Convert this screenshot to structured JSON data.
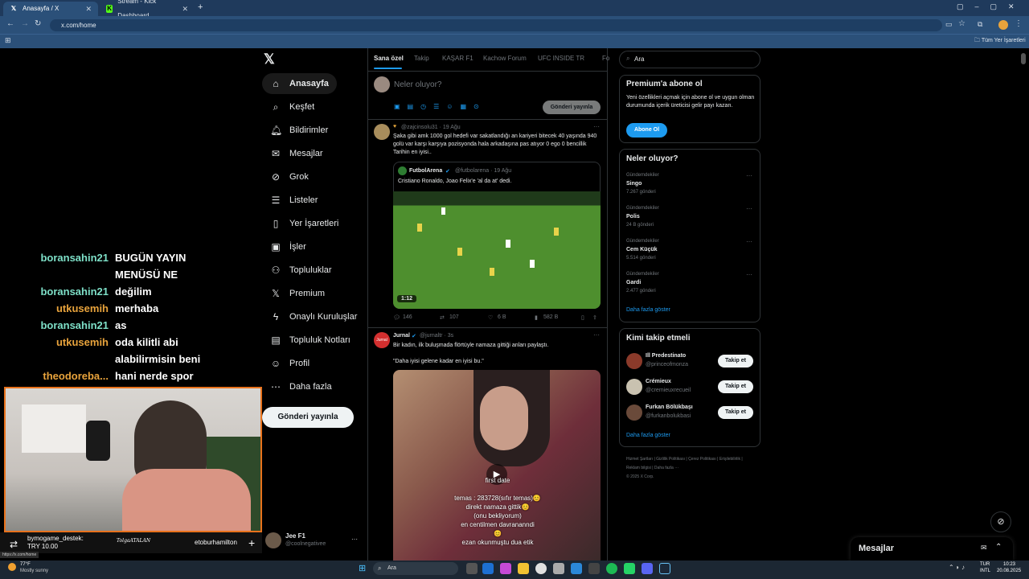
{
  "browser": {
    "tabs": [
      {
        "label": "Anasayfa / X",
        "icon": "x-logo-icon"
      },
      {
        "label": "Stream - Kick Dashboard",
        "icon": "kick-logo-icon"
      }
    ],
    "new_tab": "+",
    "url": "x.com/home",
    "bookmarks_folder": "Tüm Yer İşaretleri"
  },
  "x": {
    "nav": [
      {
        "label": "Anasayfa",
        "icon": "home-icon"
      },
      {
        "label": "Keşfet",
        "icon": "search-icon"
      },
      {
        "label": "Bildirimler",
        "icon": "bell-icon"
      },
      {
        "label": "Mesajlar",
        "icon": "mail-icon"
      },
      {
        "label": "Grok",
        "icon": "grok-icon"
      },
      {
        "label": "Listeler",
        "icon": "list-icon"
      },
      {
        "label": "Yer İşaretleri",
        "icon": "bookmark-icon"
      },
      {
        "label": "İşler",
        "icon": "briefcase-icon"
      },
      {
        "label": "Topluluklar",
        "icon": "people-icon"
      },
      {
        "label": "Premium",
        "icon": "x-premium-icon"
      },
      {
        "label": "Onaylı Kuruluşlar",
        "icon": "lightning-icon"
      },
      {
        "label": "Topluluk Notları",
        "icon": "notes-icon"
      },
      {
        "label": "Profil",
        "icon": "profile-icon"
      },
      {
        "label": "Daha fazla",
        "icon": "more-icon"
      }
    ],
    "post_button": "Gönderi yayınla",
    "account": {
      "name": "Jee F1",
      "handle": "@coolnegativee",
      "more": "···"
    },
    "feed_tabs": [
      "Sana özel",
      "Takip",
      "KAŞAR F1",
      "Kachow Forum",
      "UFC INSIDE TR",
      "Fo"
    ],
    "composer": {
      "placeholder": "Neler oluyor?",
      "post_button": "Gönderi yayınla"
    },
    "tweets": [
      {
        "handle": "@zajcinsolu31 · 19 Ağu",
        "text": "Şaka gibi amk 1000 gol hedefi var sakatlandığı an kariyeri bitecek 40 yaşında 940 golü var karşı karşıya pozisyonda hala arkadaşına pas atıyor 0 ego 0 bencillik Tarihin en iyisi..",
        "quote": {
          "name": "FutbolArena",
          "handle": "@futbolarena · 19 Ağu",
          "text": "Cristiano Ronaldo, Joao Felix'e 'al da at' dedi.",
          "duration": "1:12"
        },
        "stats": {
          "replies": "146",
          "reposts": "107",
          "likes": "6 B",
          "views": "582 B"
        }
      },
      {
        "name": "Jurnal",
        "handle": "@jurnaltr · 3s",
        "text": "Bir kadın, ilk buluşmada flörtüyle namaza gittiği anları paylaştı.",
        "text2": "\"Daha iyisi gelene kadar en iyisi bu.\"",
        "video_caption": [
          "first date",
          "temas : 283728(sıfır temas)😊",
          "direkt namaza gittik😊",
          "(onu bekliyorum)",
          "en centilmen davrananndi",
          "😊",
          "ezan okunmuştu dua etik"
        ]
      }
    ],
    "search_placeholder": "Ara",
    "premium": {
      "title": "Premium'a abone ol",
      "text": "Yeni özellikleri açmak için abone ol ve uygun olman durumunda içerik üreticisi gelir payı kazan.",
      "button": "Abone Ol"
    },
    "trends_title": "Neler oluyor?",
    "trends": [
      {
        "category": "Gündemdekiler",
        "name": "Singo",
        "count": "7.267 gönderi"
      },
      {
        "category": "Gündemdekiler",
        "name": "Polis",
        "count": "24 B gönderi"
      },
      {
        "category": "Gündemdekiler",
        "name": "Cem Küçük",
        "count": "5.514 gönderi"
      },
      {
        "category": "Gündemdekiler",
        "name": "Gardi",
        "count": "2.477 gönderi"
      }
    ],
    "show_more": "Daha fazla göster",
    "who_to_follow_title": "Kimi takip etmeli",
    "suggestions": [
      {
        "name": "Ill Predestinato",
        "handle": "@princeofmonza",
        "button": "Takip et"
      },
      {
        "name": "Crémieux",
        "handle": "@cremieuxrecueil",
        "button": "Takip et"
      },
      {
        "name": "Furkan Bölükbaşı",
        "handle": "@furkanbolukbasi",
        "button": "Takip et"
      }
    ],
    "show_more2": "Daha fazla göster",
    "footer": [
      "Hizmet Şartları",
      "Gizlilik Politikası",
      "Çerez Politikası",
      "Erişilebilirlik",
      "Reklam bilgisi",
      "Daha fazla ···",
      "© 2025 X Corp."
    ],
    "messages_drawer": "Mesajlar"
  },
  "stream_chat": [
    {
      "user": "boransahin21",
      "color": "#7ee0c8",
      "msg": "BUGÜN YAYIN"
    },
    {
      "user": "",
      "color": "#7ee0c8",
      "msg": "MENÜSÜ NE"
    },
    {
      "user": "boransahin21",
      "color": "#7ee0c8",
      "msg": "değilim"
    },
    {
      "user": "utkusemih",
      "color": "#e8a33c",
      "msg": "merhaba"
    },
    {
      "user": "boransahin21",
      "color": "#7ee0c8",
      "msg": "as"
    },
    {
      "user": "utkusemih",
      "color": "#e8a33c",
      "msg": "oda kilitli abi"
    },
    {
      "user": "",
      "color": "#e8a33c",
      "msg": "alabilirmisin beni"
    },
    {
      "user": "theodoreba...",
      "color": "#e8a33c",
      "msg": "hani nerde spor"
    },
    {
      "user": "",
      "color": "#e8a33c",
      "msg": "yayınları"
    }
  ],
  "stream_overlay": {
    "donor": "bymogame_destek:",
    "amount": "TRY 10.00",
    "signature": "TolgaATALAN",
    "follower": "etoburhamilton",
    "status_url": "https://x.com/home"
  },
  "taskbar": {
    "weather_temp": "77°F",
    "weather_text": "Mostly sunny",
    "search": "Ara",
    "lang": "TUR",
    "layout": "INTL",
    "time": "10:23",
    "date": "20.08.2025"
  },
  "colors": {
    "accent": "#1d9bf0",
    "browser": "#2b5079",
    "overlay_border": "#e8721c"
  }
}
